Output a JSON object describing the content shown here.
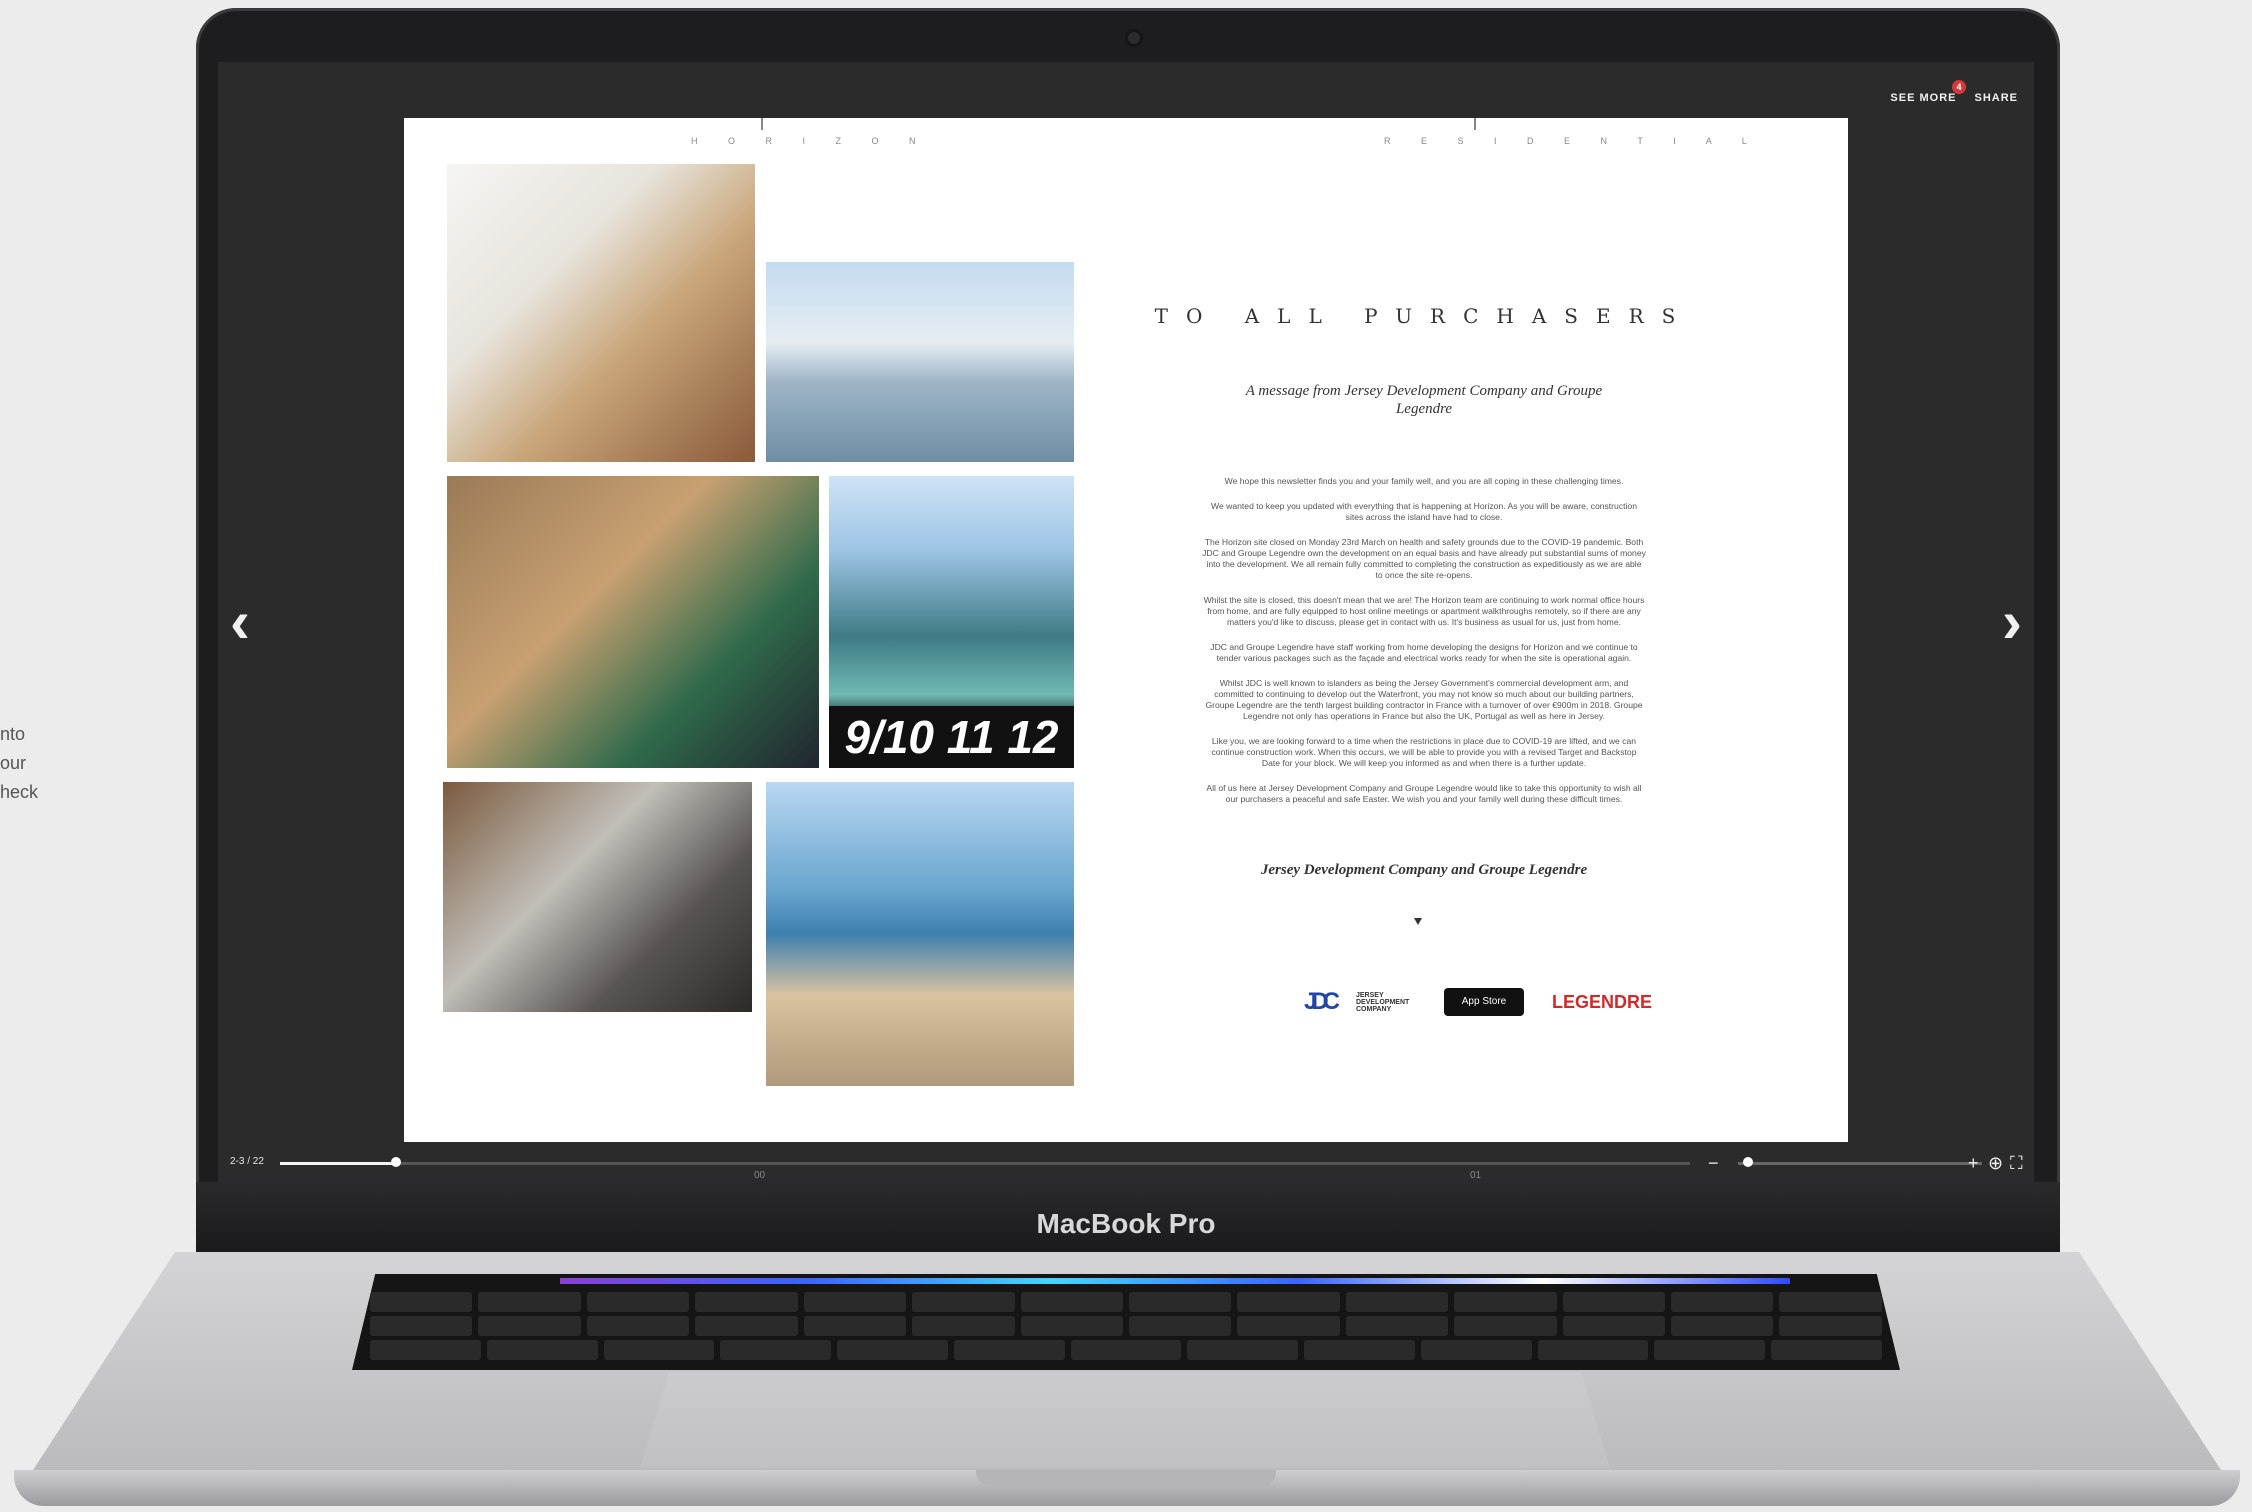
{
  "side_text": [
    "nto",
    "our",
    "heck"
  ],
  "device": {
    "brand_label": "MacBook Pro"
  },
  "reader": {
    "top_controls": {
      "see_more": "SEE MORE",
      "see_more_badge": "4",
      "share": "SHARE"
    },
    "page_indicator": "2-3 / 22",
    "progress": 0.082,
    "zoom_level": 0.04
  },
  "spread": {
    "left_header": "H O R I Z O N",
    "right_header": "R E S I D E N T I A L",
    "left_folio": "00",
    "right_folio": "01",
    "photo_caption_numbers": "9/10 11 12",
    "title": "TO ALL PURCHASERS",
    "subtitle": "A message from Jersey Development Company and Groupe Legendre",
    "paragraphs": [
      "We hope this newsletter finds you and your family well, and you are all coping in these challenging times.",
      "We wanted to keep you updated with everything that is happening at Horizon. As you will be aware, construction sites across the island have had to close.",
      "The Horizon site closed on Monday 23rd March on health and safety grounds due to the COVID-19 pandemic. Both JDC and Groupe Legendre own the development on an equal basis and have already put substantial sums of money into the development. We all remain fully committed to completing the construction as expeditiously as we are able to once the site re-opens.",
      "Whilst the site is closed, this doesn't mean that we are! The Horizon team are continuing to work normal office hours from home, and are fully equipped to host online meetings or apartment walkthroughs remotely, so if there are any matters you'd like to discuss, please get in contact with us. It's business as usual for us, just from home.",
      "JDC and Groupe Legendre have staff working from home developing the designs for Horizon and we continue to tender various packages such as the façade and electrical works ready for when the site is operational again.",
      "Whilst JDC is well known to islanders as being the Jersey Government's commercial development arm, and committed to continuing to develop out the Waterfront, you may not know so much about our building partners, Groupe Legendre are the tenth largest building contractor in France with a turnover of over €900m in 2018. Groupe Legendre not only has operations in France but also the UK, Portugal as well as here in Jersey.",
      "Like you, we are looking forward to a time when the restrictions in place due to COVID-19 are lifted, and we can continue construction work. When this occurs, we will be able to provide you with a revised Target and Backstop Date for your block. We will keep you informed as and when there is a further update.",
      "All of us here at Jersey Development Company and Groupe Legendre would like to take this opportunity to wish all our purchasers a peaceful and safe Easter. We wish you and your family well during these difficult times."
    ],
    "signoff": "Jersey Development Company and Groupe Legendre",
    "logos": {
      "jdc_mark": "JDC",
      "jdc_text": "JERSEY DEVELOPMENT COMPANY",
      "appstore": "App Store",
      "legendre": "LEGENDRE"
    }
  },
  "icons": [
    "chevron-left-icon",
    "chevron-right-icon",
    "zoom-icon",
    "fullscreen-icon",
    "apple-icon"
  ]
}
